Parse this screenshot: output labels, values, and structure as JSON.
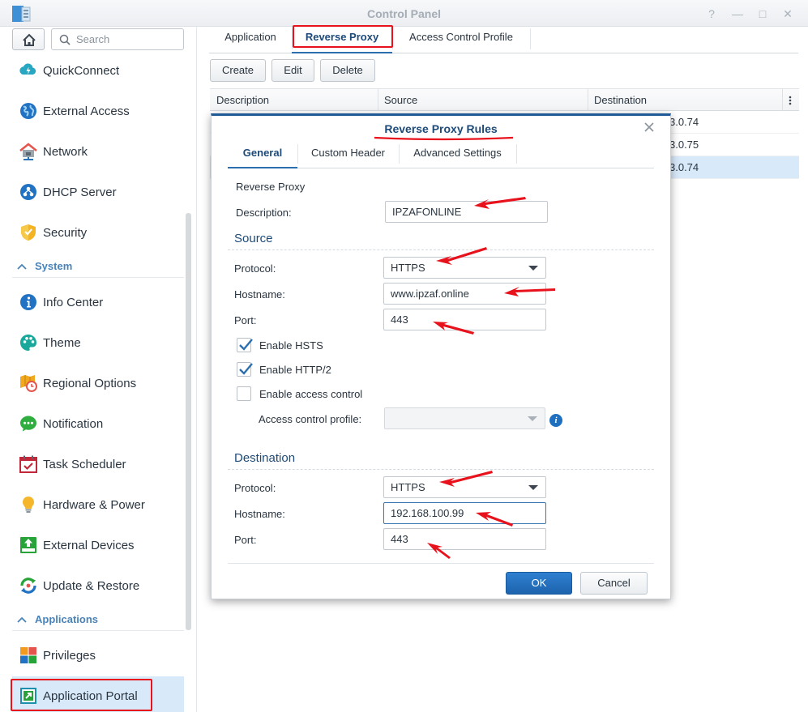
{
  "window": {
    "title": "Control Panel",
    "controls": {
      "help": "?",
      "minimize": "—",
      "maximize": "□",
      "close": "✕"
    }
  },
  "sidebar": {
    "search_placeholder": "Search",
    "items": [
      {
        "label": "QuickConnect",
        "icon": "quickconnect-icon"
      },
      {
        "label": "External Access",
        "icon": "globe-icon"
      },
      {
        "label": "Network",
        "icon": "network-house-icon"
      },
      {
        "label": "DHCP Server",
        "icon": "dhcp-icon"
      },
      {
        "label": "Security",
        "icon": "shield-icon"
      }
    ],
    "section_system": "System",
    "system_items": [
      {
        "label": "Info Center",
        "icon": "info-icon"
      },
      {
        "label": "Theme",
        "icon": "palette-icon"
      },
      {
        "label": "Regional Options",
        "icon": "map-clock-icon"
      },
      {
        "label": "Notification",
        "icon": "chat-bubble-icon"
      },
      {
        "label": "Task Scheduler",
        "icon": "calendar-check-icon"
      },
      {
        "label": "Hardware & Power",
        "icon": "lightbulb-icon"
      },
      {
        "label": "External Devices",
        "icon": "upload-device-icon"
      },
      {
        "label": "Update & Restore",
        "icon": "update-icon"
      }
    ],
    "section_applications": "Applications",
    "app_items": [
      {
        "label": "Privileges",
        "icon": "privileges-grid-icon"
      },
      {
        "label": "Application Portal",
        "icon": "portal-arrow-icon"
      }
    ]
  },
  "main": {
    "tabs": [
      "Application",
      "Reverse Proxy",
      "Access Control Profile"
    ],
    "toolbar": {
      "create": "Create",
      "edit": "Edit",
      "delete": "Delete"
    },
    "columns": [
      "Description",
      "Source",
      "Destination"
    ],
    "rows": [
      {
        "destination": "3.0.74"
      },
      {
        "destination": "3.0.75"
      },
      {
        "destination": "3.0.74"
      }
    ]
  },
  "dialog": {
    "title": "Reverse Proxy Rules",
    "tabs": [
      "General",
      "Custom Header",
      "Advanced Settings"
    ],
    "group_label": "Reverse Proxy",
    "description_label": "Description:",
    "description_value": "IPZAFONLINE",
    "source": {
      "title": "Source",
      "protocol_label": "Protocol:",
      "protocol_value": "HTTPS",
      "hostname_label": "Hostname:",
      "hostname_value": "www.ipzaf.online",
      "port_label": "Port:",
      "port_value": "443",
      "hsts_label": "Enable HSTS",
      "http2_label": "Enable HTTP/2",
      "access_control_label": "Enable access control",
      "access_profile_label": "Access control profile:"
    },
    "destination": {
      "title": "Destination",
      "protocol_label": "Protocol:",
      "protocol_value": "HTTPS",
      "hostname_label": "Hostname:",
      "hostname_value": "192.168.100.99",
      "port_label": "Port:",
      "port_value": "443"
    },
    "ok": "OK",
    "cancel": "Cancel"
  },
  "colors": {
    "accent": "#1d4a79",
    "selected_row": "#d8e9f9",
    "primary_button": "#1f6bb8",
    "annotation_red": "#e8121c"
  }
}
